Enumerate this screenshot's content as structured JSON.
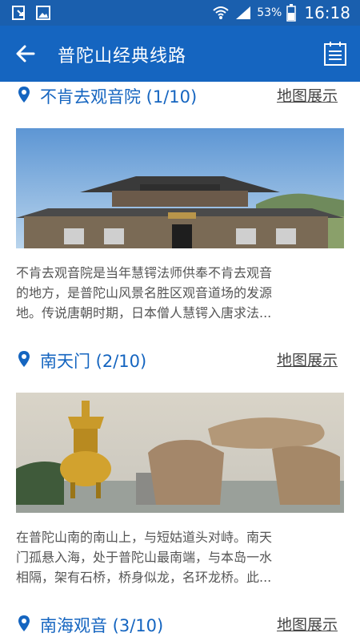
{
  "status_bar": {
    "battery": "53%",
    "time": "16:18"
  },
  "app_bar": {
    "title": "普陀山经典线路"
  },
  "items": [
    {
      "title": "不肯去观音院 (1/10)",
      "map_link": "地图展示",
      "desc_lines": [
        "不肯去观音院是当年慧锷法师供奉不肯去观音",
        "的地方，是普陀山风景名胜区观音道场的发源",
        "地。传说唐朝时期，日本僧人慧锷入唐求法..."
      ]
    },
    {
      "title": "南天门 (2/10)",
      "map_link": "地图展示",
      "desc_lines": [
        "在普陀山南的南山上，与短姑道头对峙。南天",
        "门孤悬入海，处于普陀山最南端，与本岛一水",
        "相隔，架有石桥，桥身似龙，名环龙桥。此..."
      ]
    },
    {
      "title": "南海观音 (3/10)",
      "map_link": "地图展示"
    }
  ],
  "colors": {
    "status_bar": "#1a5fae",
    "app_bar": "#1565c0",
    "title_text": "#1565c0",
    "desc_text": "#555555"
  },
  "icons": {
    "back": "arrow-left-icon",
    "menu": "list-icon",
    "pin": "location-pin-icon"
  }
}
